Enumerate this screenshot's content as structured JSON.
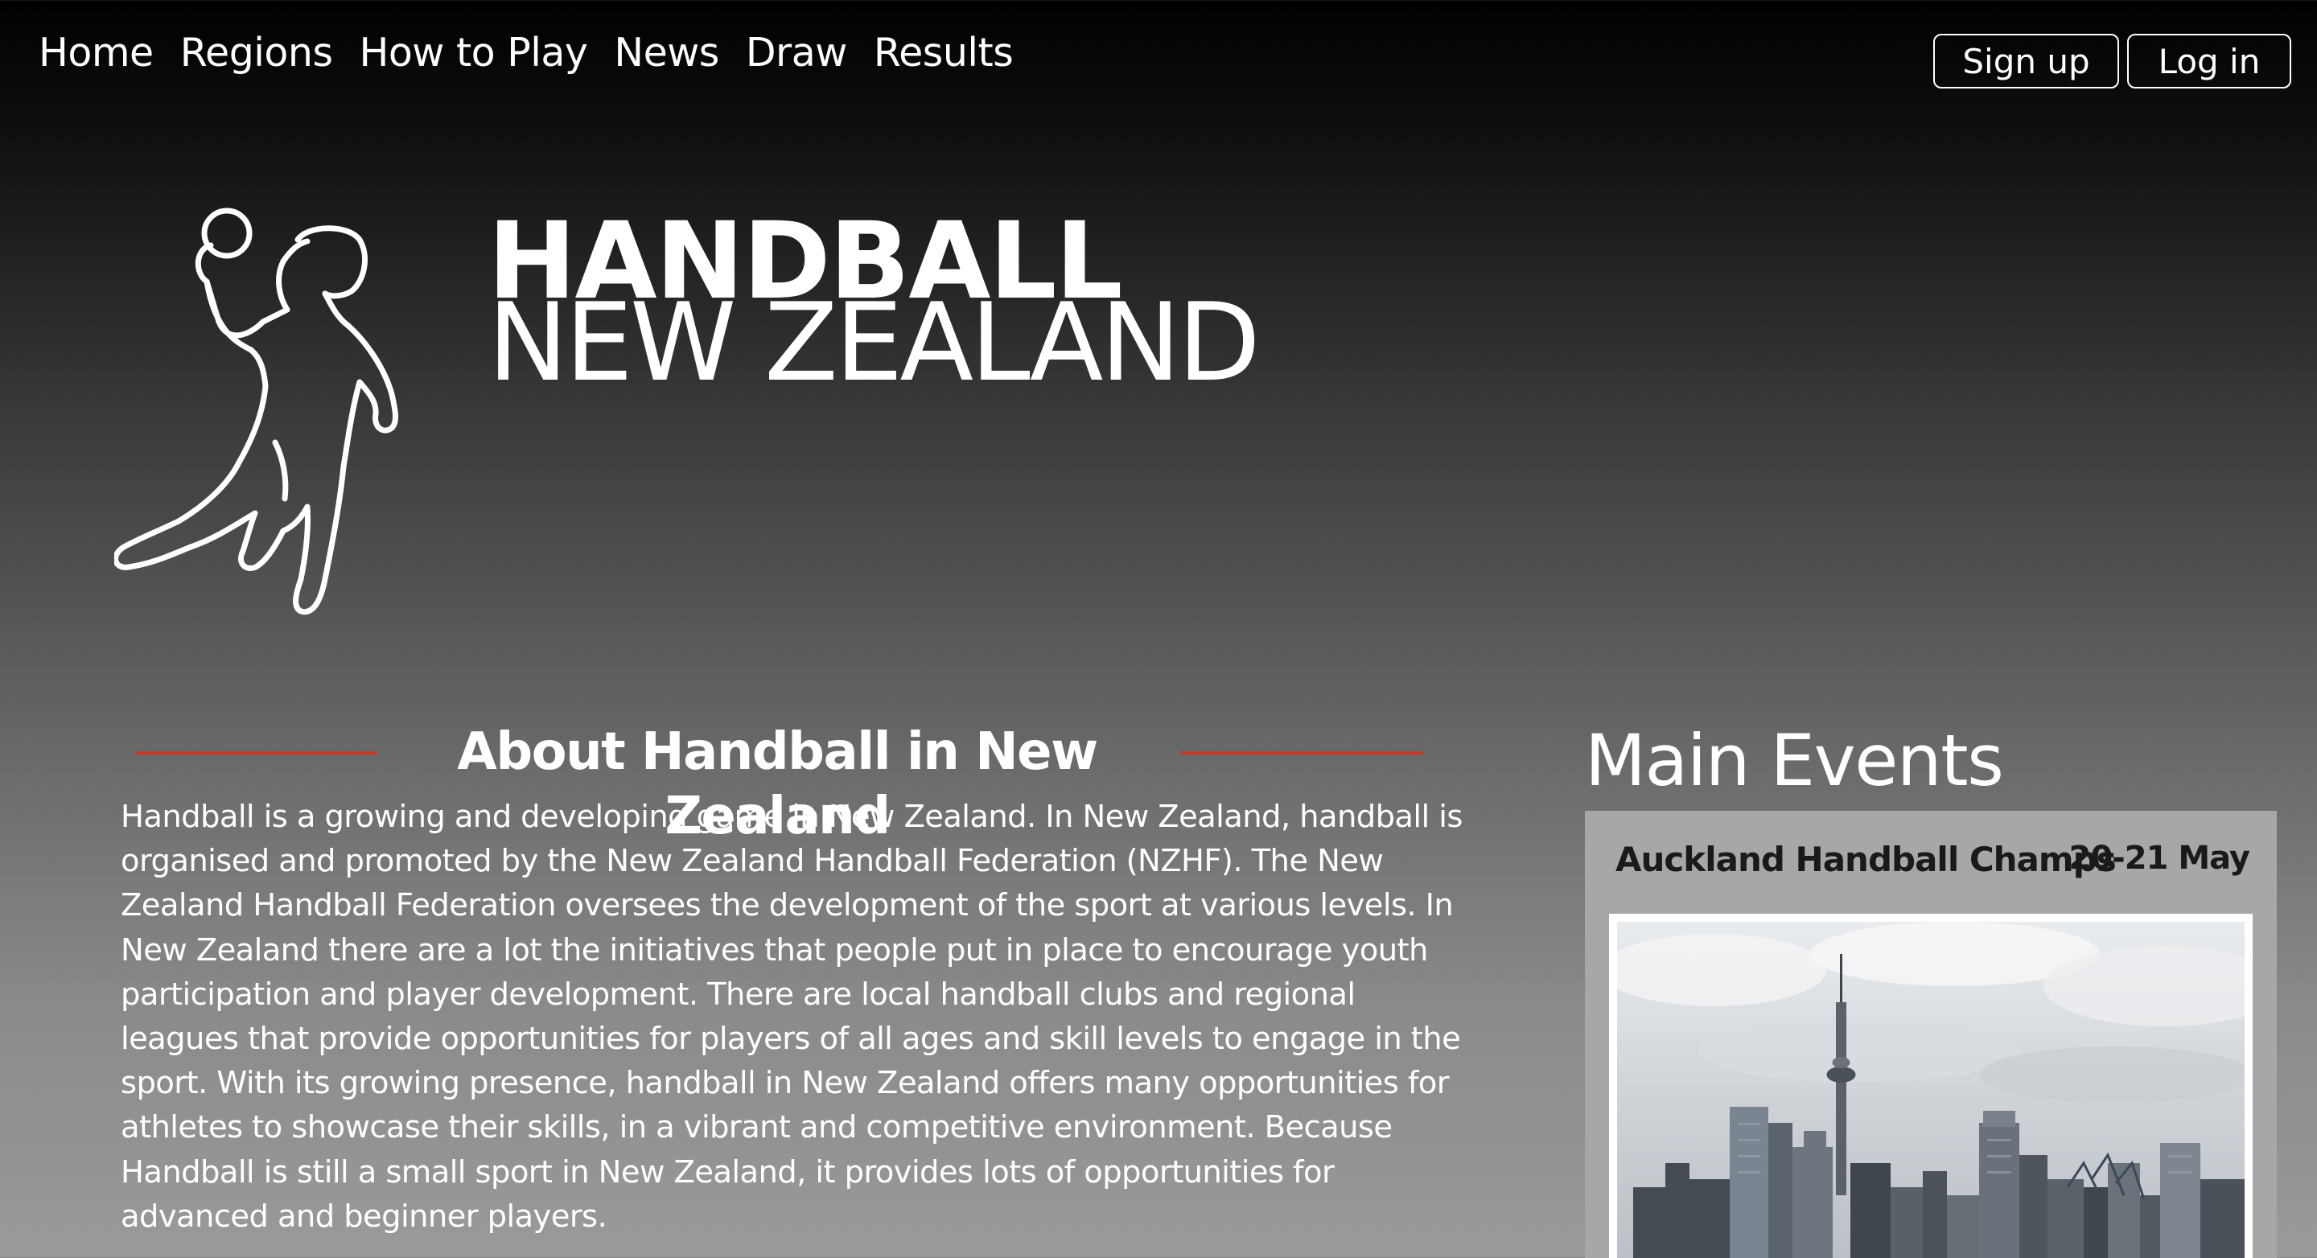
{
  "nav": {
    "items": [
      {
        "label": "Home"
      },
      {
        "label": "Regions"
      },
      {
        "label": "How to Play"
      },
      {
        "label": "News"
      },
      {
        "label": "Draw"
      },
      {
        "label": "Results"
      }
    ]
  },
  "auth": {
    "signup_label": "Sign up",
    "login_label": "Log in"
  },
  "logo": {
    "line1": "HANDBALL",
    "line2": "NEW ZEALAND",
    "figure_icon": "handball-player-icon"
  },
  "about": {
    "heading": "About Handball in New Zealand",
    "body": "Handball is a growing and developing game in New Zealand. In New Zealand, handball is organised and promoted by the New Zealand Handball Federation (NZHF). The New Zealand Handball Federation oversees the development of the sport at various levels. In New Zealand there are a lot the initiatives that people put in place to encourage youth participation and player development. There are local handball clubs and regional leagues that provide opportunities for players of all ages and skill levels to engage in the sport. With its growing presence, handball in New Zealand offers many opportunities for athletes to showcase their skills, in a vibrant and competitive environment. Because Handball is still a small sport in New Zealand, it provides lots of opportunities for advanced and beginner players."
  },
  "events": {
    "title": "Main Events",
    "items": [
      {
        "name": "Auckland Handball Champs",
        "date": "20-21 May"
      }
    ]
  },
  "colors": {
    "accent_rule": "#c0392b",
    "card_bg": "#a7a7a7"
  }
}
